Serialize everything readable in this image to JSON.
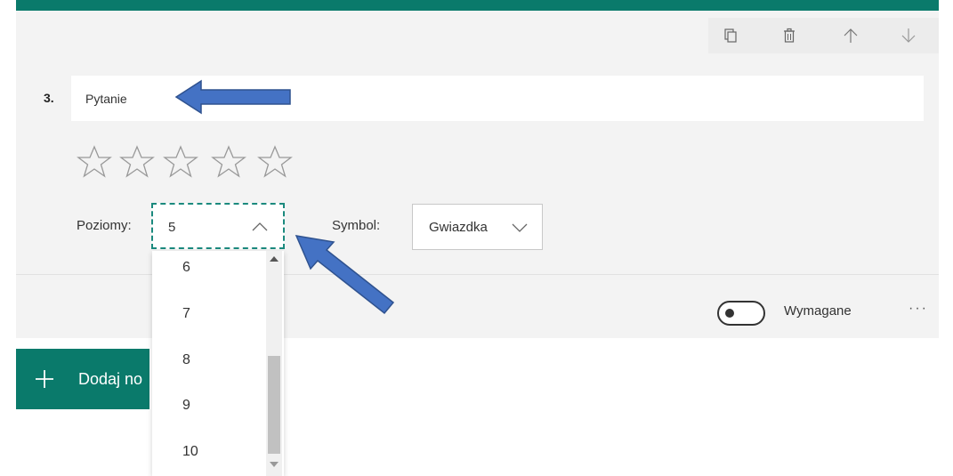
{
  "question": {
    "number": "3.",
    "text": "Pytanie"
  },
  "toolbar": {
    "copy_icon": "copy-icon",
    "delete_icon": "trash-icon",
    "up_icon": "arrow-up-icon",
    "down_icon": "arrow-down-icon"
  },
  "rating": {
    "stars": 5
  },
  "levels": {
    "label": "Poziomy:",
    "selected": "5",
    "options": [
      "6",
      "7",
      "8",
      "9",
      "10"
    ]
  },
  "symbol": {
    "label": "Symbol:",
    "selected": "Gwiazdka"
  },
  "footer": {
    "required_label": "Wymagane",
    "required_on": false,
    "more": "···"
  },
  "add_button": {
    "label": "Dodaj no"
  },
  "colors": {
    "accent": "#0a7a6b",
    "arrow": "#4472c4"
  }
}
